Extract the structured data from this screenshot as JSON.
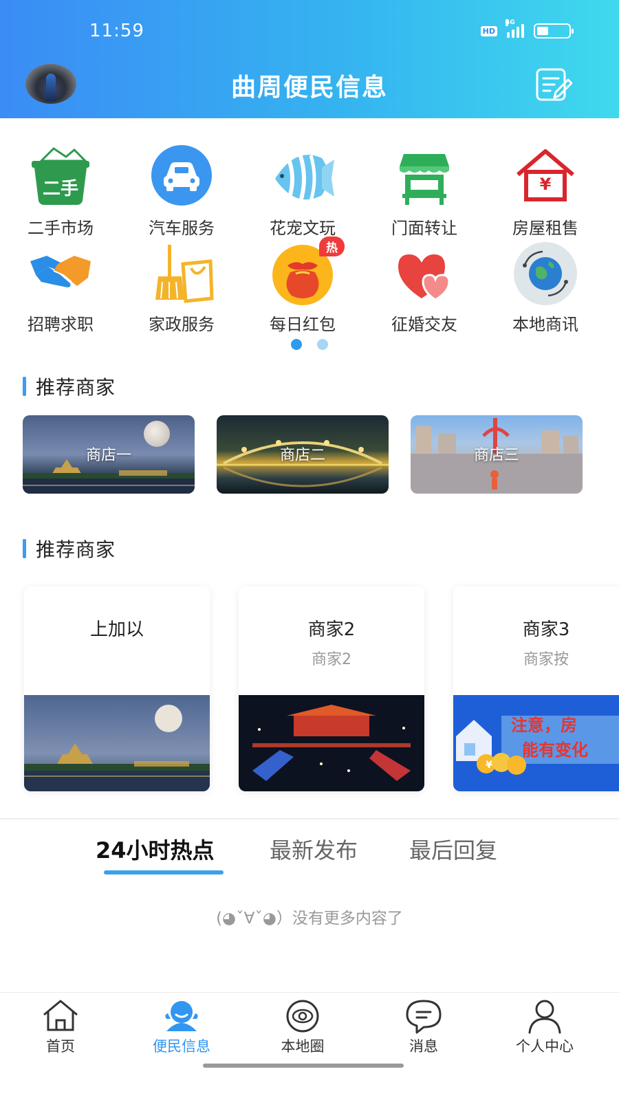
{
  "status_bar": {
    "time": "11:59",
    "hd": "HD",
    "network": "4G",
    "battery_level": 0.35
  },
  "header": {
    "title": "曲周便民信息"
  },
  "categories": [
    {
      "label": "二手市场",
      "icon": "secondhand-basket-icon",
      "icon_text": "二手"
    },
    {
      "label": "汽车服务",
      "icon": "car-icon"
    },
    {
      "label": "花宠文玩",
      "icon": "fish-icon"
    },
    {
      "label": "门面转让",
      "icon": "storefront-icon"
    },
    {
      "label": "房屋租售",
      "icon": "house-yuan-icon",
      "icon_text": "¥"
    },
    {
      "label": "招聘求职",
      "icon": "handshake-icon"
    },
    {
      "label": "家政服务",
      "icon": "broom-bag-icon"
    },
    {
      "label": "每日红包",
      "icon": "red-envelope-bag-icon",
      "badge": "热"
    },
    {
      "label": "征婚交友",
      "icon": "hearts-icon"
    },
    {
      "label": "本地商讯",
      "icon": "globe-icon"
    }
  ],
  "pager": {
    "pages": 2,
    "current": 0
  },
  "shops_section": {
    "title": "推荐商家",
    "shops": [
      {
        "name": "商店一"
      },
      {
        "name": "商店二"
      },
      {
        "name": "商店三"
      }
    ]
  },
  "merchants_section": {
    "title": "推荐商家",
    "cards": [
      {
        "title": "上加以",
        "subtitle": ""
      },
      {
        "title": "商家2",
        "subtitle": "商家2"
      },
      {
        "title": "商家3",
        "subtitle": "商家按",
        "image_text_1": "注意，房",
        "image_text_2": "能有变化"
      }
    ]
  },
  "feed_tabs": [
    {
      "label": "24小时热点"
    },
    {
      "label": "最新发布"
    },
    {
      "label": "最后回复"
    }
  ],
  "empty_message": "(◕ˇ∀ˇ◕）没有更多内容了",
  "bottom_nav": [
    {
      "label": "首页",
      "icon": "home-icon"
    },
    {
      "label": "便民信息",
      "icon": "service-person-icon"
    },
    {
      "label": "本地圈",
      "icon": "planet-icon"
    },
    {
      "label": "消息",
      "icon": "chat-bubble-icon"
    },
    {
      "label": "个人中心",
      "icon": "person-icon"
    }
  ],
  "colors": {
    "accent": "#3296f0",
    "header_start": "#3b8cf5",
    "header_end": "#3fd9ee",
    "hot": "#ef3b3b"
  }
}
